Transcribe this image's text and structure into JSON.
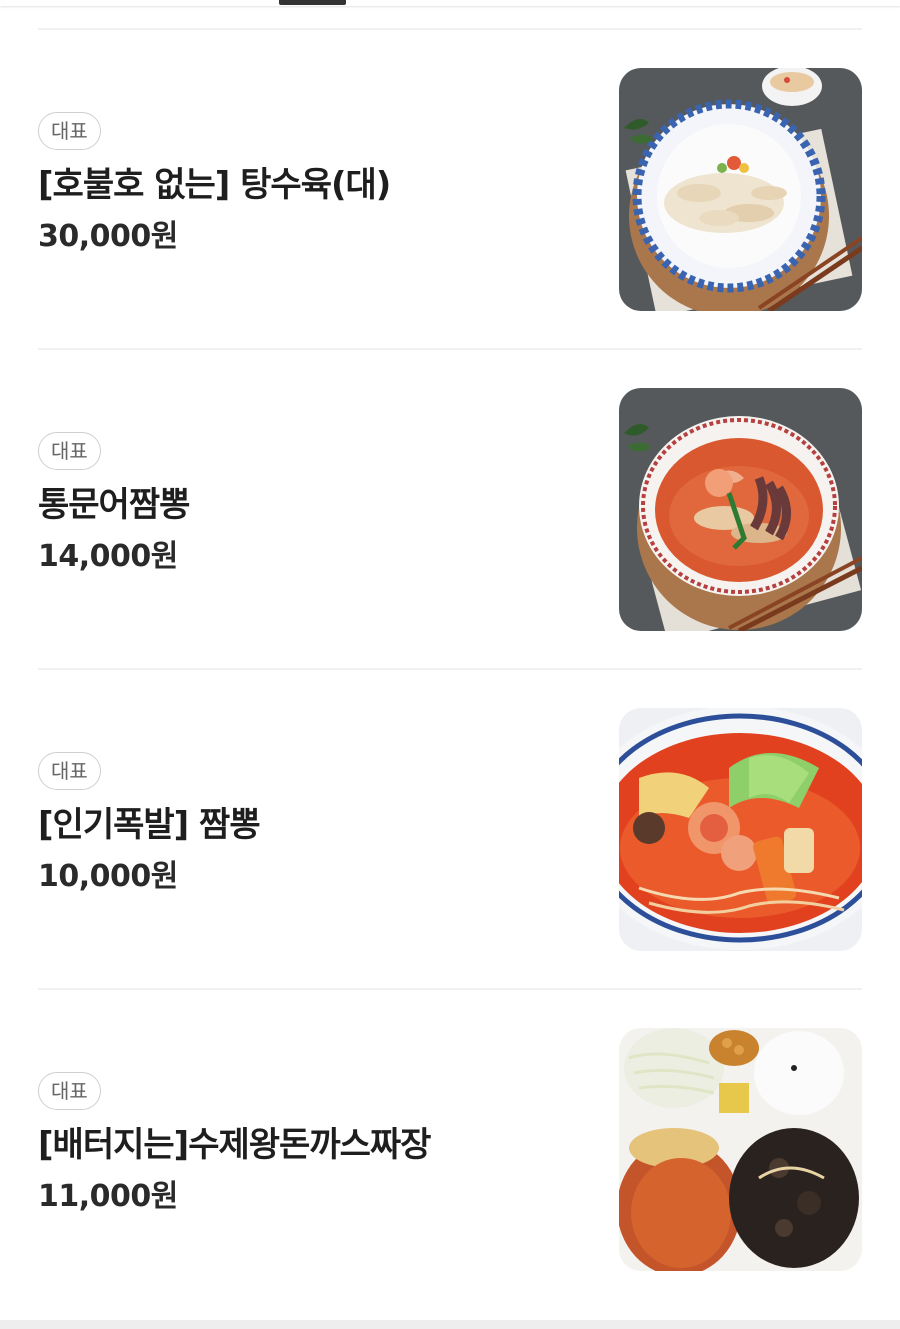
{
  "menu": {
    "items": [
      {
        "badge": "대표",
        "name": "[호불호 없는] 탕수육(대)",
        "price": "30,000원",
        "image": "sweet-sour-pork-photo"
      },
      {
        "badge": "대표",
        "name": "통문어짬뽕",
        "price": "14,000원",
        "image": "octopus-jjamppong-photo"
      },
      {
        "badge": "대표",
        "name": "[인기폭발] 짬뽕",
        "price": "10,000원",
        "image": "jjamppong-photo"
      },
      {
        "badge": "대표",
        "name": "[배터지는]수제왕돈까스짜장",
        "price": "11,000원",
        "image": "pork-cutlet-jjajang-photo"
      }
    ]
  }
}
